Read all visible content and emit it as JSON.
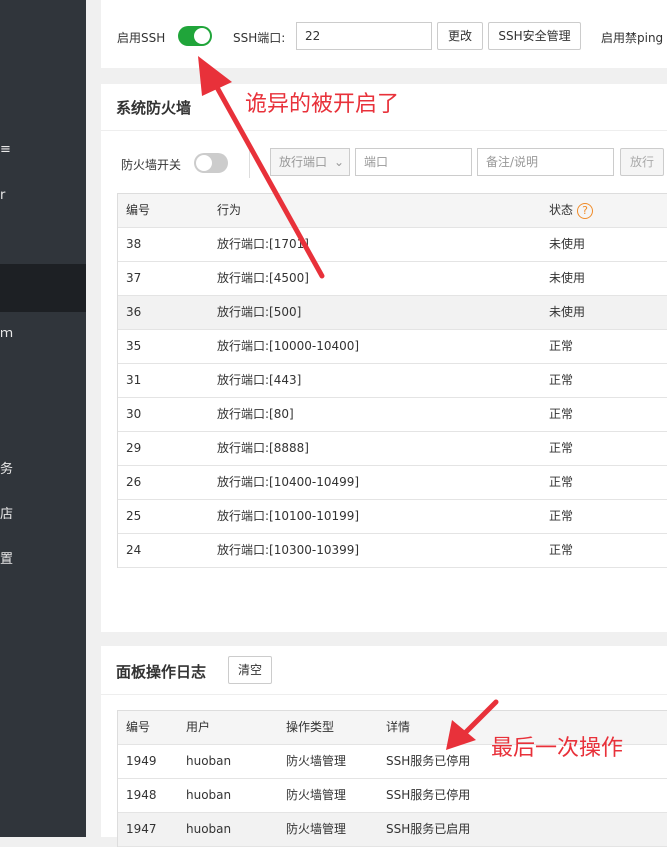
{
  "sidebar": {
    "fragments": [
      " ",
      "r",
      "",
      "",
      "务",
      "店",
      "置"
    ]
  },
  "ssh": {
    "enable_label": "启用SSH",
    "port_label": "SSH端口:",
    "port_value": "22",
    "change_btn": "更改",
    "manage_btn": "SSH安全管理",
    "ping_label": "启用禁ping"
  },
  "firewall": {
    "title": "系统防火墙",
    "switch_label": "防火墙开关",
    "select_value": "放行端口",
    "port_placeholder": "端口",
    "note_placeholder": "备注/说明",
    "allow_btn": "放行",
    "columns": [
      "编号",
      "行为",
      "状态"
    ],
    "rows": [
      [
        "38",
        "放行端口:[1701]",
        "未使用"
      ],
      [
        "37",
        "放行端口:[4500]",
        "未使用"
      ],
      [
        "36",
        "放行端口:[500]",
        "未使用"
      ],
      [
        "35",
        "放行端口:[10000-10400]",
        "正常"
      ],
      [
        "31",
        "放行端口:[443]",
        "正常"
      ],
      [
        "30",
        "放行端口:[80]",
        "正常"
      ],
      [
        "29",
        "放行端口:[8888]",
        "正常"
      ],
      [
        "26",
        "放行端口:[10400-10499]",
        "正常"
      ],
      [
        "25",
        "放行端口:[10100-10199]",
        "正常"
      ],
      [
        "24",
        "放行端口:[10300-10399]",
        "正常"
      ]
    ]
  },
  "log": {
    "title": "面板操作日志",
    "clear_btn": "清空",
    "columns": [
      "编号",
      "用户",
      "操作类型",
      "详情"
    ],
    "rows": [
      [
        "1949",
        "huoban",
        "防火墙管理",
        "SSH服务已停用"
      ],
      [
        "1948",
        "huoban",
        "防火墙管理",
        "SSH服务已停用"
      ],
      [
        "1947",
        "huoban",
        "防火墙管理",
        "SSH服务已启用"
      ]
    ]
  },
  "annotations": {
    "top": "诡异的被开启了",
    "bottom": "最后一次操作"
  },
  "colors": {
    "accent_green": "#20a53a",
    "annotation_red": "#e8313a",
    "sidebar_bg": "#30353b",
    "help_orange": "#f08c2a"
  }
}
